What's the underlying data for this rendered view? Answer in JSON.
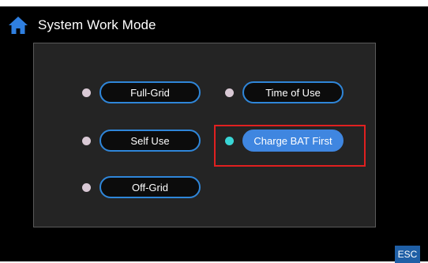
{
  "header": {
    "title": "System Work Mode",
    "icon": "home-icon"
  },
  "modes": [
    {
      "label": "Full-Grid",
      "selected": false
    },
    {
      "label": "Self Use",
      "selected": false
    },
    {
      "label": "Off-Grid",
      "selected": false
    },
    {
      "label": "Time of Use",
      "selected": false
    },
    {
      "label": "Charge BAT First",
      "selected": true
    }
  ],
  "footer": {
    "esc_label": "ESC"
  },
  "colors": {
    "background": "#000000",
    "panel": "#242424",
    "accent": "#3f86e0",
    "selected_dot": "#39d6d6",
    "highlight_border": "#e02020",
    "home_icon": "#2f7fe0"
  }
}
